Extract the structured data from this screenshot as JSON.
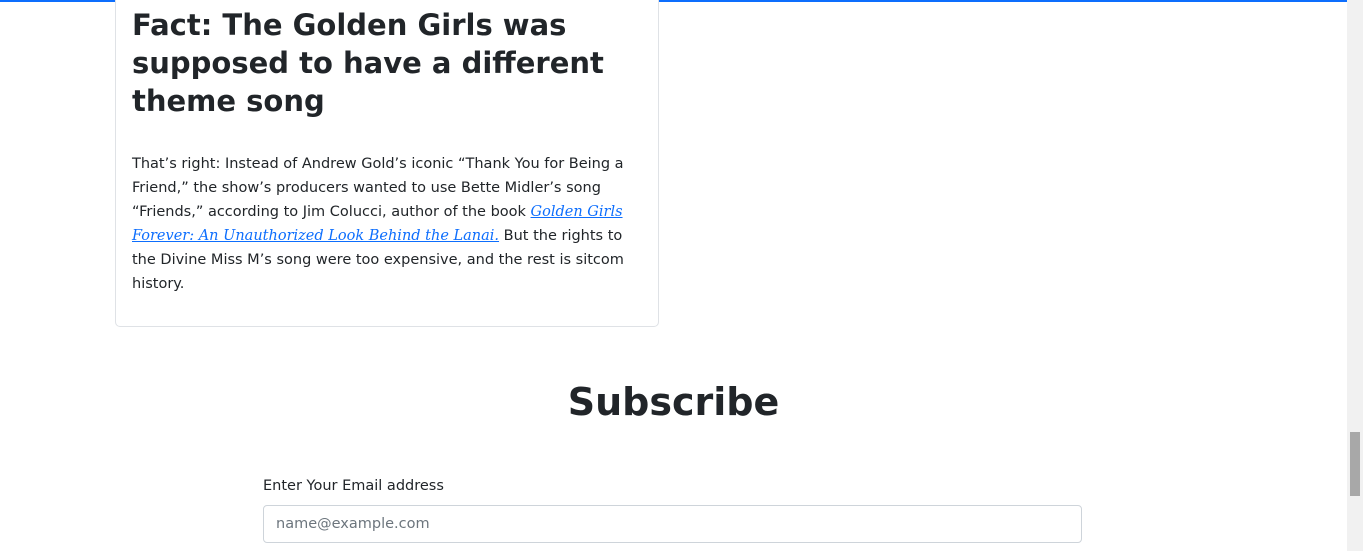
{
  "article": {
    "title": "Fact: The Golden Girls was supposed to have a different theme song",
    "body_before_link": "That’s right: Instead of Andrew Gold’s iconic “Thank You for Being a Friend,” the show’s producers wanted to use Bette Midler’s song “Friends,” according to Jim Colucci, author of the book ",
    "link_text": "Golden Girls Forever: An Unauthorized Look Behind the Lanai.",
    "body_after_link": " But the rights to the Divine Miss M’s song were too expensive, and the rest is sitcom history."
  },
  "subscribe": {
    "title": "Subscribe",
    "email_label": "Enter Your Email address",
    "email_placeholder": "name@example.com",
    "email_value": ""
  },
  "colors": {
    "accent": "#0d6efd",
    "text": "#212529",
    "border": "#dfe2e6"
  }
}
